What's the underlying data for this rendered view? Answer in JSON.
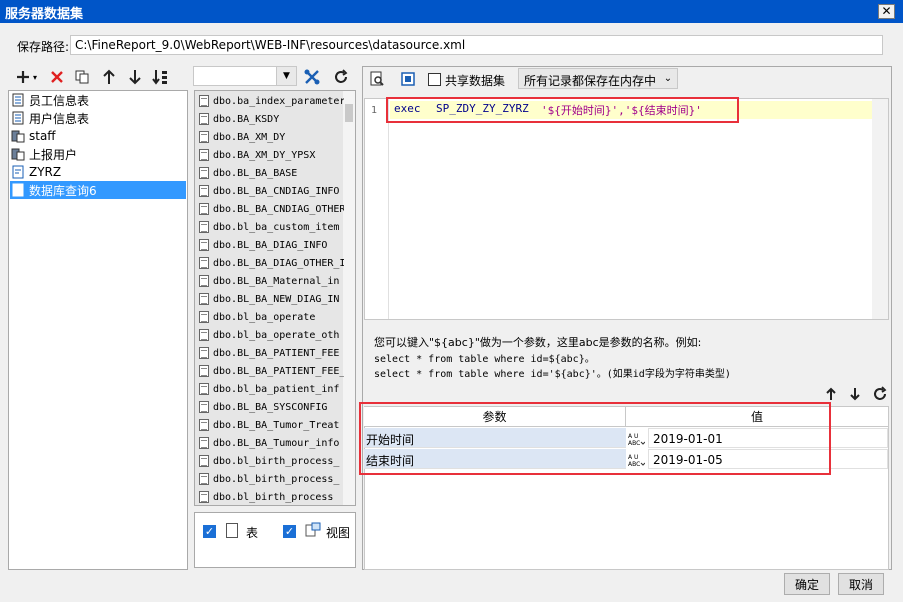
{
  "window": {
    "title": "服务器数据集",
    "close": "✕"
  },
  "path": {
    "label": "保存路径:",
    "value": "C:\\FineReport_9.0\\WebReport\\WEB-INF\\resources\\datasource.xml"
  },
  "datasets": {
    "items": [
      {
        "label": "员工信息表",
        "icon": "table-icon"
      },
      {
        "label": "用户信息表",
        "icon": "table-icon"
      },
      {
        "label": "staff",
        "icon": "database-icon"
      },
      {
        "label": "上报用户",
        "icon": "database-icon"
      },
      {
        "label": "ZYRZ",
        "icon": "sql-icon"
      },
      {
        "label": "数据库查询6",
        "icon": "sql-icon",
        "selected": true
      }
    ]
  },
  "tables": {
    "items": [
      "dbo.ba_index_parameter",
      "dbo.BA_KSDY",
      "dbo.BA_XM_DY",
      "dbo.BA_XM_DY_YPSX",
      "dbo.BL_BA_BASE",
      "dbo.BL_BA_CNDIAG_INFO",
      "dbo.BL_BA_CNDIAG_OTHER",
      "dbo.bl_ba_custom_item",
      "dbo.BL_BA_DIAG_INFO",
      "dbo.BL_BA_DIAG_OTHER_I",
      "dbo.BL_BA_Maternal_in",
      "dbo.BL_BA_NEW_DIAG_IN",
      "dbo.bl_ba_operate",
      "dbo.bl_ba_operate_oth",
      "dbo.BL_BA_PATIENT_FEE",
      "dbo.BL_BA_PATIENT_FEE_",
      "dbo.bl_ba_patient_inf",
      "dbo.BL_BA_SYSCONFIG",
      "dbo.BL_BA_Tumor_Treat",
      "dbo.BL_BA_Tumour_info",
      "dbo.bl_birth_process_",
      "dbo.bl_birth_process_",
      "dbo.bl_birth_process"
    ],
    "show_tables_label": "表",
    "show_views_label": "视图"
  },
  "editor": {
    "share_label": "共享数据集",
    "cache_select": "所有记录都保存在内存中",
    "line_number": "1",
    "sql_kw": "exec",
    "sql_proc": "SP_ZDY_ZY_ZYRZ",
    "sql_args": "'${开始时间}','${结束时间}'"
  },
  "help": {
    "line1": "您可以键入\"${abc}\"做为一个参数，这里abc是参数的名称。例如:",
    "line2": "select * from table where id=${abc}。",
    "line3": "select * from table where id='${abc}'。(如果id字段为字符串类型)"
  },
  "params": {
    "col_name": "参数",
    "col_value": "值",
    "rows": [
      {
        "name": "开始时间",
        "value": "2019-01-01"
      },
      {
        "name": "结束时间",
        "value": "2019-01-05"
      }
    ]
  },
  "buttons": {
    "ok": "确定",
    "cancel": "取消"
  },
  "colors": {
    "title": "#0055c8",
    "highlight": "#e8303a",
    "selected": "#3399ff"
  }
}
